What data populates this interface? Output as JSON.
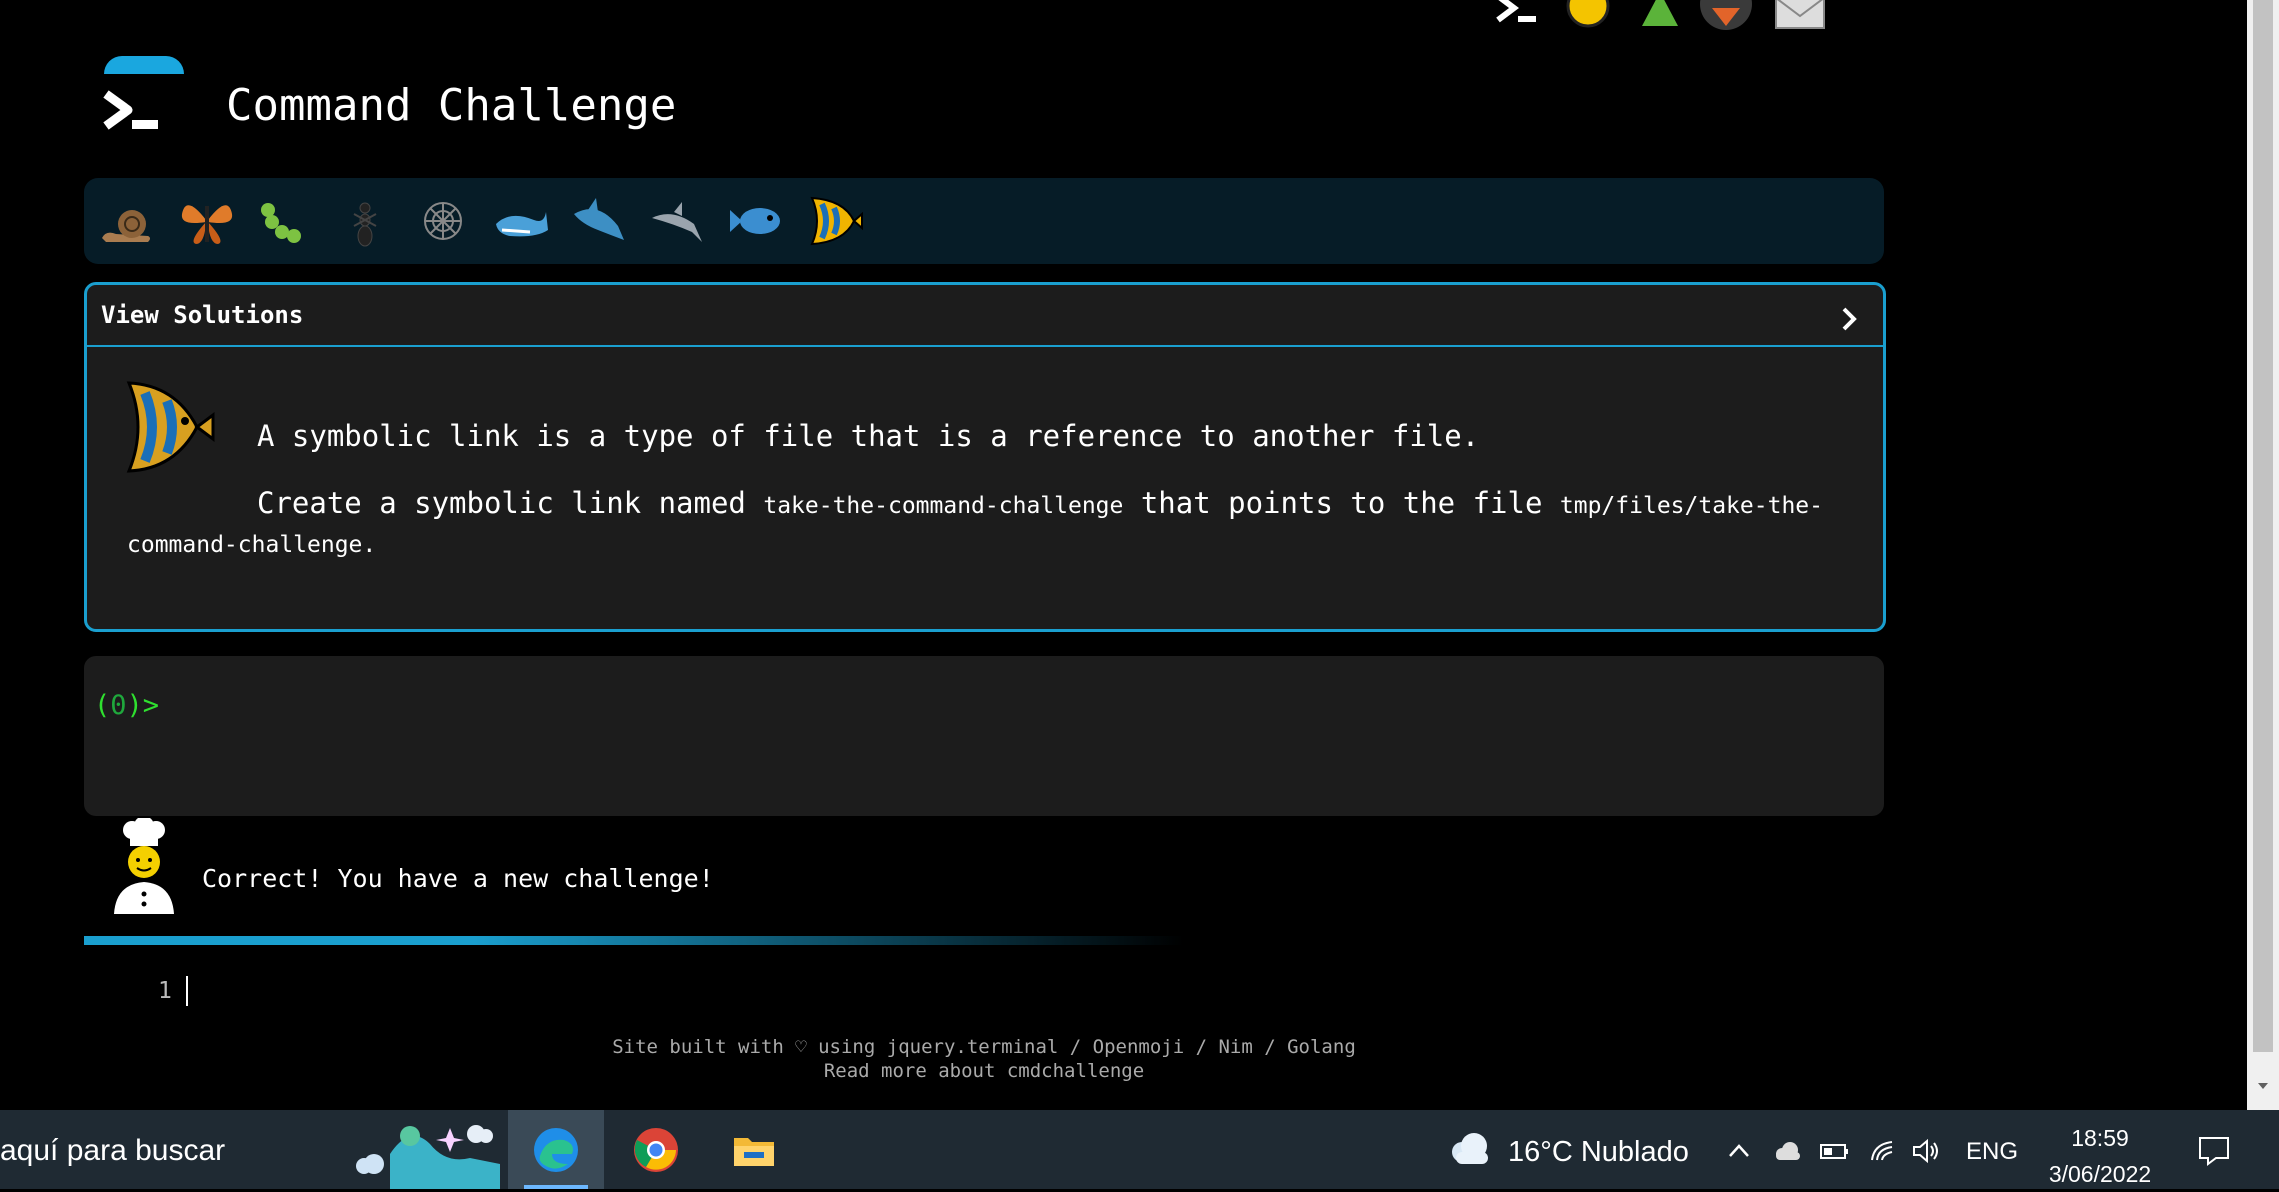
{
  "site": {
    "title": "Command Challenge",
    "top_icons": [
      "terminal-icon",
      "yellow-hand-icon",
      "tree-icon",
      "fox-icon",
      "envelope-icon"
    ]
  },
  "levels": [
    "snail-icon",
    "butterfly-icon",
    "caterpillar-icon",
    "ant-icon",
    "spider-web-icon",
    "whale-icon",
    "shark-icon",
    "dolphin-icon",
    "fish-icon",
    "tropical-fish-icon"
  ],
  "problem": {
    "header": "View Solutions",
    "line1": "A symbolic link is a type of file that is a reference to another file.",
    "line2_a": "Create a symbolic link named",
    "line2_code1": "take-the-command-challenge",
    "line2_b": "that points to the file",
    "line2_code2": "tmp/files/take-the-command-challenge",
    "line2_end": "."
  },
  "terminal": {
    "prompt_open": "(",
    "prompt_count": "0",
    "prompt_close": ")>"
  },
  "feedback": {
    "message": "Correct! You have a new challenge!"
  },
  "editor": {
    "line_number": "1"
  },
  "footer": {
    "line1": "Site built with ♡ using jquery.terminal / Openmoji / Nim / Golang",
    "line2": "Read more about cmdchallenge"
  },
  "taskbar": {
    "search_placeholder": "aquí para buscar",
    "weather": "16°C  Nublado",
    "language": "ENG",
    "time": "18:59",
    "date": "3/06/2022"
  },
  "colors": {
    "accent": "#1a9fcf",
    "prompt": "#2fe02f",
    "panel": "#1c1c1c",
    "level_bar": "#061c27"
  }
}
